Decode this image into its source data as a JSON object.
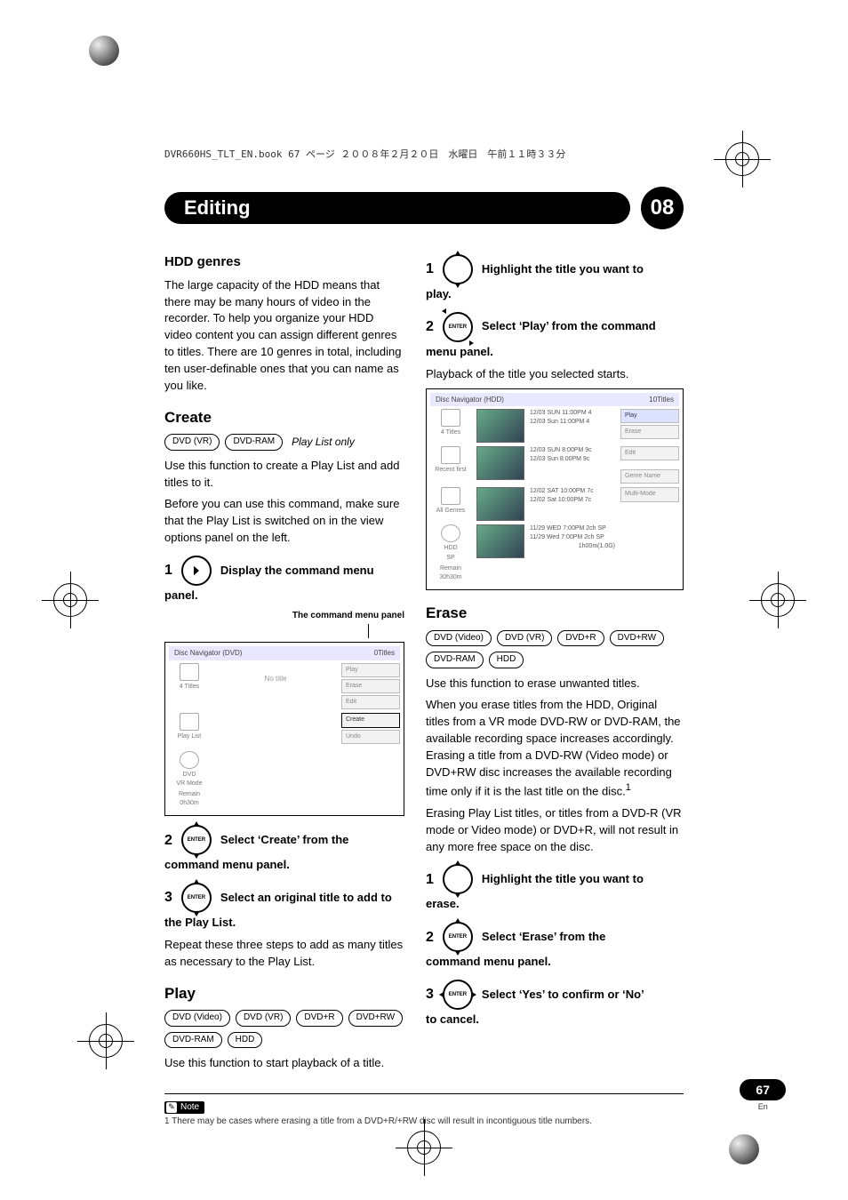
{
  "header_line": "DVR660HS_TLT_EN.book  67 ページ  ２００８年２月２０日　水曜日　午前１１時３３分",
  "chapter": {
    "title": "Editing",
    "number": "08"
  },
  "page": {
    "number": "67",
    "lang": "En"
  },
  "note_label": "Note",
  "footnote": "1 There may be cases where erasing a title from a DVD+R/+RW disc will result in incontiguous title numbers.",
  "left": {
    "hdd_genres": {
      "heading": "HDD genres",
      "body": "The large capacity of the HDD means that there may be many hours of video in the recorder. To help you organize your HDD video content you can assign different genres to titles. There are 10 genres in total, including ten user-definable ones that you can name as you like."
    },
    "create": {
      "heading": "Create",
      "badges": [
        "DVD (VR)",
        "DVD-RAM"
      ],
      "badge_note": "Play List only",
      "p1": "Use this function to create a Play List and add titles to it.",
      "p2": "Before you can use this command, make sure that the Play List is switched on in the view options panel on the left.",
      "step1_num": "1",
      "step1_a": "Display the command menu",
      "step1_b": "panel.",
      "caption": "The command menu panel",
      "step2_num": "2",
      "step2_a": "Select ‘Create’ from the",
      "step2_b": "command menu panel.",
      "step3_num": "3",
      "step3_a": "Select an original title to add to",
      "step3_b": "the Play List.",
      "step3_body": "Repeat these three steps to add as many titles as necessary to the Play List."
    },
    "play": {
      "heading": "Play",
      "badges": [
        "DVD (Video)",
        "DVD (VR)",
        "DVD+R",
        "DVD+RW",
        "DVD-RAM",
        "HDD"
      ],
      "body": "Use this function to start playback of a title."
    },
    "nav_dvd": {
      "title_left": "Disc Navigator (DVD)",
      "title_right": "0Titles",
      "side1": "4 Titles",
      "side2": "Play List",
      "side3_a": "DVD",
      "side3_b": "VR Mode",
      "remain_label": "Remain",
      "remain_val": "0h30m",
      "no_title": "No title",
      "cmd_play": "Play",
      "cmd_erase": "Erase",
      "cmd_edit": "Edit",
      "cmd_create": "Create",
      "cmd_undo": "Undo"
    }
  },
  "right": {
    "play_steps": {
      "s1_num": "1",
      "s1_a": "Highlight the title you want to",
      "s1_b": "play.",
      "s2_num": "2",
      "s2_a": "Select ‘Play’ from the command",
      "s2_b": "menu panel.",
      "s2_body": "Playback of the title you selected starts."
    },
    "erase": {
      "heading": "Erase",
      "badges": [
        "DVD (Video)",
        "DVD (VR)",
        "DVD+R",
        "DVD+RW",
        "DVD-RAM",
        "HDD"
      ],
      "p1": "Use this function to erase unwanted titles.",
      "p2": "When you erase titles from the HDD, Original titles from a VR mode DVD-RW or DVD-RAM, the available recording space increases accordingly. Erasing a title from a DVD-RW (Video mode) or DVD+RW disc increases the available recording time only if it is the last title on the disc.",
      "p2_sup": "1",
      "p3": "Erasing Play List titles, or titles from a DVD-R (VR mode or Video mode) or DVD+R, will not result in any more free space on the disc.",
      "s1_num": "1",
      "s1_a": "Highlight the title you want to",
      "s1_b": "erase.",
      "s2_num": "2",
      "s2_a": "Select ‘Erase’ from the",
      "s2_b": "command menu panel.",
      "s3_num": "3",
      "s3_a": "Select ‘Yes’ to confirm or ‘No’",
      "s3_b": "to cancel."
    },
    "nav_hdd": {
      "title_left": "Disc Navigator (HDD)",
      "title_right": "10Titles",
      "side1": "4 Titles",
      "side2": "Recent first",
      "side3": "All Genres",
      "side4_a": "HDD",
      "side4_b": "SP",
      "remain_label": "Remain",
      "remain_val": "30h30m",
      "r1a": "12/03 SUN 11:00PM 4",
      "r1b": "12/03 Sun 11:00PM 4",
      "r2a": "12/03 SUN 8:00PM 9c",
      "r2b": "12/03  Sun  8:00PM 9c",
      "r3a": "12/02 SAT 10:00PM 7c",
      "r3b": "12/02 Sat 10:00PM 7c",
      "r4a": "11/29 WED 7:00PM 2ch SP",
      "r4b": "11/29 Wed 7:00PM 2ch SP",
      "r4c": "1h00m(1.0G)",
      "cmd_play": "Play",
      "cmd_erase": "Erase",
      "cmd_edit": "Edit",
      "cmd_genre": "Genre Name",
      "cmd_multi": "Multi-Mode"
    }
  }
}
